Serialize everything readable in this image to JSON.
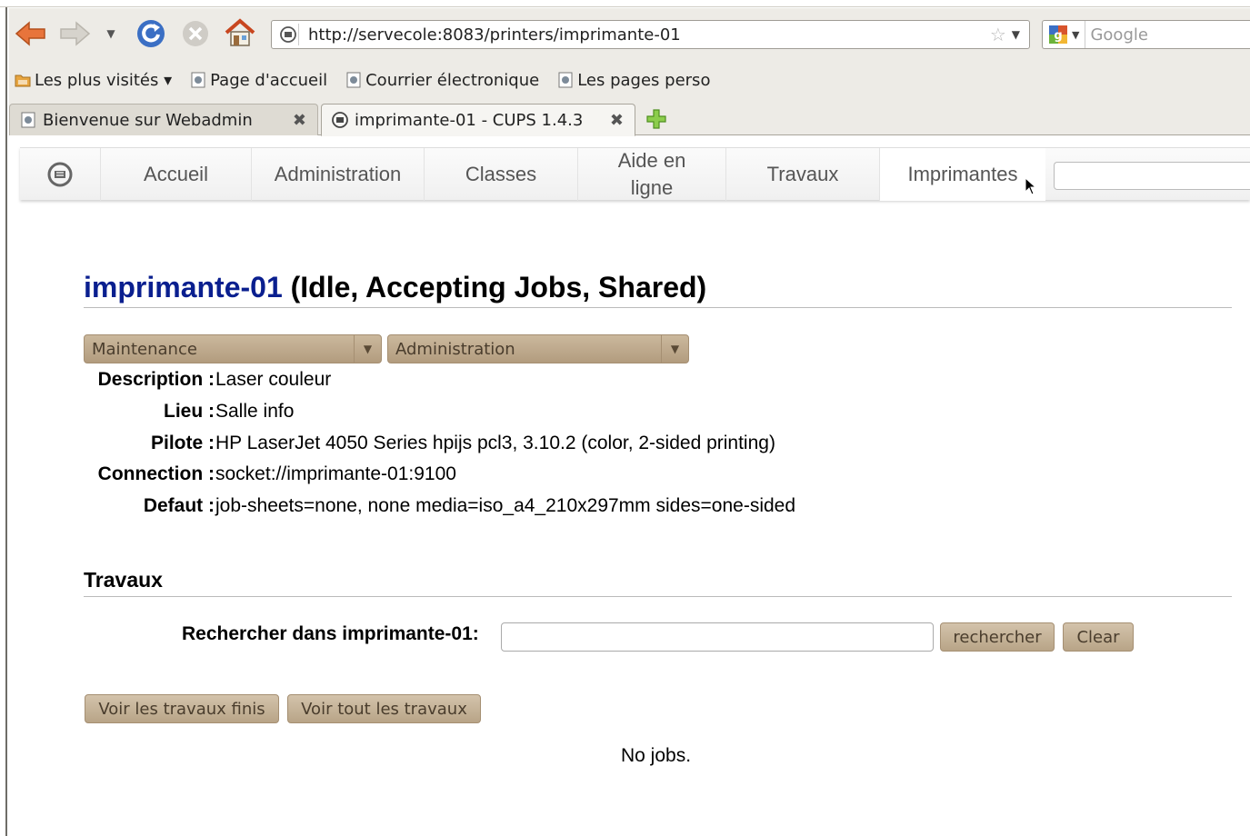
{
  "browser": {
    "url": "http://servecole:8083/printers/imprimante-01",
    "search_placeholder": "Google",
    "bookmarks": [
      {
        "label": "Les plus visités ▾",
        "icon": "folder-icon"
      },
      {
        "label": "Page d'accueil",
        "icon": "page-icon"
      },
      {
        "label": "Courrier électronique",
        "icon": "page-icon"
      },
      {
        "label": "Les pages perso",
        "icon": "page-icon"
      }
    ],
    "tabs": [
      {
        "label": "Bienvenue sur Webadmin",
        "active": false,
        "icon": "page-icon"
      },
      {
        "label": "imprimante-01 - CUPS 1.4.3",
        "active": true,
        "icon": "cups-icon"
      }
    ],
    "colors": {
      "accent_back": "#e8743b",
      "home": "#d8542c",
      "reload": "#3b6fc4",
      "new_tab": "#6cb33a"
    }
  },
  "cups": {
    "nav": [
      {
        "label": "Accueil"
      },
      {
        "label": "Administration"
      },
      {
        "label": "Classes"
      },
      {
        "label": "Aide en ligne"
      },
      {
        "label": "Travaux"
      },
      {
        "label": "Imprimantes",
        "active": true
      }
    ],
    "printer": {
      "name": "imprimante-01",
      "status": "(Idle, Accepting Jobs, Shared)"
    },
    "menus": {
      "maintenance": "Maintenance",
      "administration": "Administration"
    },
    "details": {
      "description": {
        "label": "Description :",
        "value": "Laser couleur"
      },
      "lieu": {
        "label": "Lieu :",
        "value": "Salle info"
      },
      "pilote": {
        "label": "Pilote :",
        "value": "HP LaserJet 4050 Series hpijs pcl3, 3.10.2 (color, 2-sided printing)"
      },
      "connection": {
        "label": "Connection :",
        "value": "socket://imprimante-01:9100"
      },
      "defaut": {
        "label": "Defaut :",
        "value": "job-sheets=none, none media=iso_a4_210x297mm sides=one-sided"
      }
    },
    "jobs": {
      "heading": "Travaux",
      "search_label": "Rechercher dans imprimante-01:",
      "search_button": "rechercher",
      "clear_button": "Clear",
      "show_completed": "Voir les travaux finis",
      "show_all": "Voir tout les travaux",
      "empty_message": "No jobs."
    },
    "colors": {
      "printer_name": "#0a1f8f",
      "button": "#c4b193"
    }
  }
}
